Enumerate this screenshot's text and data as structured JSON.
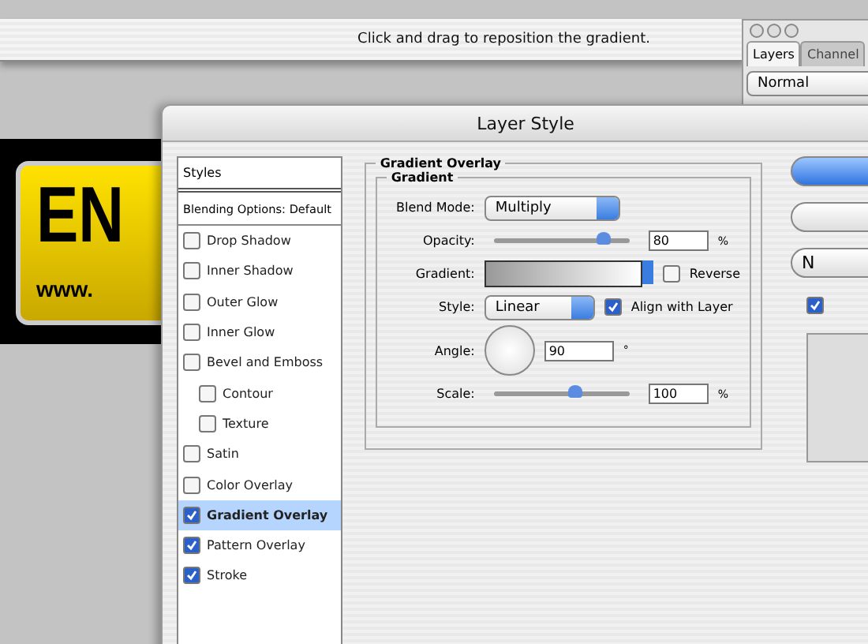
{
  "options_bar": {
    "hint": "Click and drag to reposition the gradient."
  },
  "layers_panel": {
    "tabs": [
      {
        "label": "Layers",
        "selected": true
      },
      {
        "label": "Channel",
        "selected": false
      }
    ],
    "blend_mode": "Normal"
  },
  "canvas": {
    "headline": "EN",
    "url": "www."
  },
  "dialog": {
    "title": "Layer Style",
    "styles_header": "Styles",
    "blending_options": "Blending Options: Default",
    "styles": [
      {
        "label": "Drop Shadow",
        "checked": false,
        "selected": false
      },
      {
        "label": "Inner Shadow",
        "checked": false,
        "selected": false
      },
      {
        "label": "Outer Glow",
        "checked": false,
        "selected": false
      },
      {
        "label": "Inner Glow",
        "checked": false,
        "selected": false
      },
      {
        "label": "Bevel and Emboss",
        "checked": false,
        "selected": false,
        "children": [
          {
            "label": "Contour",
            "checked": false,
            "selected": false
          },
          {
            "label": "Texture",
            "checked": false,
            "selected": false
          }
        ]
      },
      {
        "label": "Satin",
        "checked": false,
        "selected": false
      },
      {
        "label": "Color Overlay",
        "checked": false,
        "selected": false
      },
      {
        "label": "Gradient Overlay",
        "checked": true,
        "selected": true
      },
      {
        "label": "Pattern Overlay",
        "checked": true,
        "selected": false
      },
      {
        "label": "Stroke",
        "checked": true,
        "selected": false
      }
    ],
    "section_title": "Gradient Overlay",
    "group_title": "Gradient",
    "blend_mode": {
      "label": "Blend Mode:",
      "value": "Multiply"
    },
    "opacity": {
      "label": "Opacity:",
      "level": 0.8,
      "value": "80",
      "unit": "%"
    },
    "gradient": {
      "label": "Gradient:",
      "reverse_label": "Reverse",
      "reverse": false
    },
    "style": {
      "label": "Style:",
      "value": "Linear",
      "align_label": "Align with Layer",
      "align": true
    },
    "angle": {
      "label": "Angle:",
      "value": "90",
      "unit": "°"
    },
    "scale": {
      "label": "Scale:",
      "level": 0.6,
      "value": "100",
      "unit": "%"
    },
    "side_buttons": [
      {
        "kind": "default"
      },
      {
        "kind": "plain"
      },
      {
        "label": "N",
        "kind": "plain"
      }
    ],
    "preview_checked": true
  }
}
